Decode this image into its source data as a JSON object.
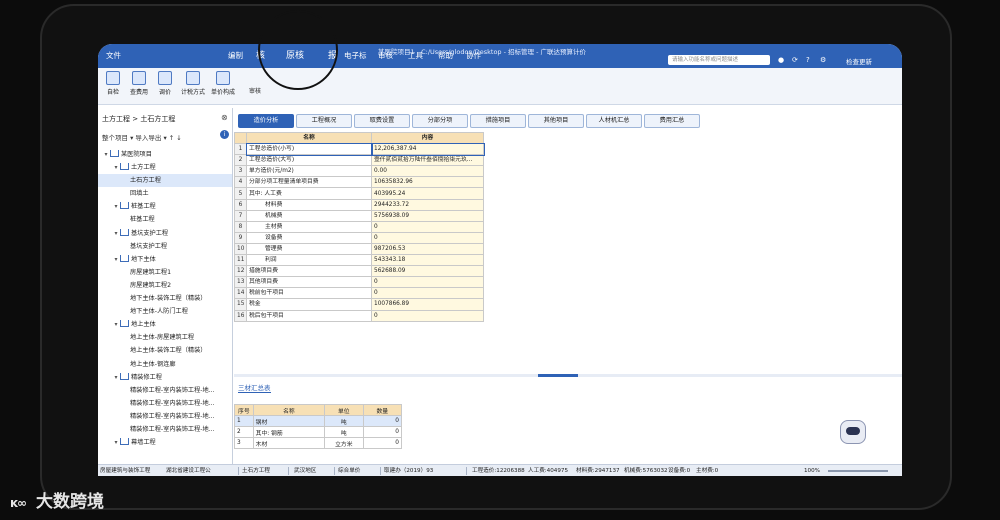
{
  "titlebar": {
    "file_menu": "文件",
    "menus": [
      "编制",
      "核",
      "原核",
      "报",
      "电子标",
      "审核",
      "工具",
      "帮助",
      "协作"
    ],
    "window_title": "某医院项目1 - C:/Users/glodon/Desktop - 招标管理 - 广联达预算计价",
    "search_placeholder": "请输入功能名称或问题描述",
    "check_update": "检查更新"
  },
  "ribbon": {
    "buttons": [
      "自检",
      "查费用",
      "调价",
      "计税方式",
      "单价构成"
    ],
    "extra": "审核"
  },
  "left_panel": {
    "path": "土方工程 > 土石方工程",
    "tools": "整个项目 ▾   导入导出 ▾   ↑  ↓",
    "tree": [
      {
        "indent": 0,
        "label": "某医院项目",
        "icon": true,
        "toggle": "▾"
      },
      {
        "indent": 1,
        "label": "土方工程",
        "icon": true,
        "toggle": "▾"
      },
      {
        "indent": 2,
        "label": "土石方工程",
        "icon": false,
        "toggle": "",
        "selected": true
      },
      {
        "indent": 2,
        "label": "回填土",
        "icon": false,
        "toggle": ""
      },
      {
        "indent": 1,
        "label": "桩基工程",
        "icon": true,
        "toggle": "▾"
      },
      {
        "indent": 2,
        "label": "桩基工程",
        "icon": false,
        "toggle": ""
      },
      {
        "indent": 1,
        "label": "基坑支护工程",
        "icon": true,
        "toggle": "▾"
      },
      {
        "indent": 2,
        "label": "基坑支护工程",
        "icon": false,
        "toggle": ""
      },
      {
        "indent": 1,
        "label": "地下主体",
        "icon": true,
        "toggle": "▾"
      },
      {
        "indent": 2,
        "label": "房屋建筑工程1",
        "icon": false,
        "toggle": ""
      },
      {
        "indent": 2,
        "label": "房屋建筑工程2",
        "icon": false,
        "toggle": ""
      },
      {
        "indent": 2,
        "label": "地下主体-装饰工程（精装）",
        "icon": false,
        "toggle": ""
      },
      {
        "indent": 2,
        "label": "地下主体-人防门工程",
        "icon": false,
        "toggle": ""
      },
      {
        "indent": 1,
        "label": "地上主体",
        "icon": true,
        "toggle": "▾"
      },
      {
        "indent": 2,
        "label": "地上主体-房屋建筑工程",
        "icon": false,
        "toggle": ""
      },
      {
        "indent": 2,
        "label": "地上主体-装饰工程（精装）",
        "icon": false,
        "toggle": ""
      },
      {
        "indent": 2,
        "label": "地上主体-钢连廊",
        "icon": false,
        "toggle": ""
      },
      {
        "indent": 1,
        "label": "精装修工程",
        "icon": true,
        "toggle": "▾"
      },
      {
        "indent": 2,
        "label": "精装修工程-室内装饰工程-地...",
        "icon": false,
        "toggle": ""
      },
      {
        "indent": 2,
        "label": "精装修工程-室内装饰工程-地...",
        "icon": false,
        "toggle": ""
      },
      {
        "indent": 2,
        "label": "精装修工程-室内装饰工程-地...",
        "icon": false,
        "toggle": ""
      },
      {
        "indent": 2,
        "label": "精装修工程-室内装饰工程-地...",
        "icon": false,
        "toggle": ""
      },
      {
        "indent": 1,
        "label": "幕墙工程",
        "icon": true,
        "toggle": "▾"
      }
    ]
  },
  "tabs": [
    "造价分析",
    "工程概况",
    "取费设置",
    "分部分项",
    "措施项目",
    "其他项目",
    "人材机汇总",
    "费用汇总"
  ],
  "grid": {
    "headers": [
      "名称",
      "内容"
    ],
    "rows": [
      [
        "1",
        "工程总造价(小写)",
        "12,206,387.94"
      ],
      [
        "2",
        "工程总造价(大写)",
        "壹仟贰佰贰拾万陆仟叁佰捌拾柒元玖..."
      ],
      [
        "3",
        "单方造价(元/m2)",
        "0.00"
      ],
      [
        "4",
        "分部分项工程量清单项目费",
        "10635832.96"
      ],
      [
        "5",
        "其中: 人工费",
        "403995.24"
      ],
      [
        "6",
        "材料费",
        "2944233.72"
      ],
      [
        "7",
        "机械费",
        "5756938.09"
      ],
      [
        "8",
        "主材费",
        "0"
      ],
      [
        "9",
        "设备费",
        "0"
      ],
      [
        "10",
        "管理费",
        "987206.53"
      ],
      [
        "11",
        "利润",
        "543343.18"
      ],
      [
        "12",
        "措施项目费",
        "562688.09"
      ],
      [
        "13",
        "其他项目费",
        "0"
      ],
      [
        "14",
        "税前包干项目",
        "0"
      ],
      [
        "15",
        "税金",
        "1007866.89"
      ],
      [
        "16",
        "税后包干项目",
        "0"
      ]
    ]
  },
  "bottom": {
    "tab": "三材汇总表",
    "headers": [
      "序号",
      "名称",
      "单位",
      "数量"
    ],
    "rows": [
      [
        "1",
        "钢材",
        "吨",
        "0"
      ],
      [
        "2",
        "其中: 钢筋",
        "吨",
        "0"
      ],
      [
        "3",
        "木材",
        "立方米",
        "0"
      ]
    ]
  },
  "statusbar": {
    "items": [
      "房屋建筑与装饰工程",
      "湖北省建设工程公",
      "土石方工程",
      "武汉地区",
      "综合单价",
      "取建办（2019）93",
      "工程造价:12206388",
      "人工费:404975",
      "材料费:2947137",
      "机械费:5763032",
      "设备费:0",
      "主材费:0"
    ],
    "zoom": "100%"
  },
  "watermark": {
    "logo": "ᴋ𝄞",
    "text": "大数跨境"
  }
}
